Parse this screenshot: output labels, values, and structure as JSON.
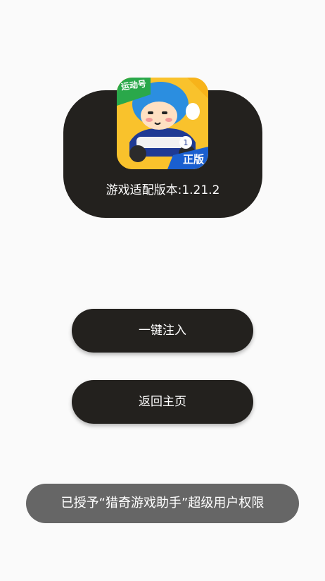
{
  "app": {
    "icon_name": "kart-racer-app-icon",
    "icon_badge_top": "运动号",
    "icon_badge_bottom": "正版",
    "version_text": "游戏适配版本:1.21.2"
  },
  "buttons": {
    "inject_label": "一键注入",
    "home_label": "返回主页"
  },
  "toast": {
    "message": "已授予“猎奇游戏助手”超级用户权限"
  },
  "colors": {
    "background": "#fafafa",
    "card": "#23211e",
    "button": "#23211e",
    "toast": "#666666",
    "text": "#ffffff"
  }
}
